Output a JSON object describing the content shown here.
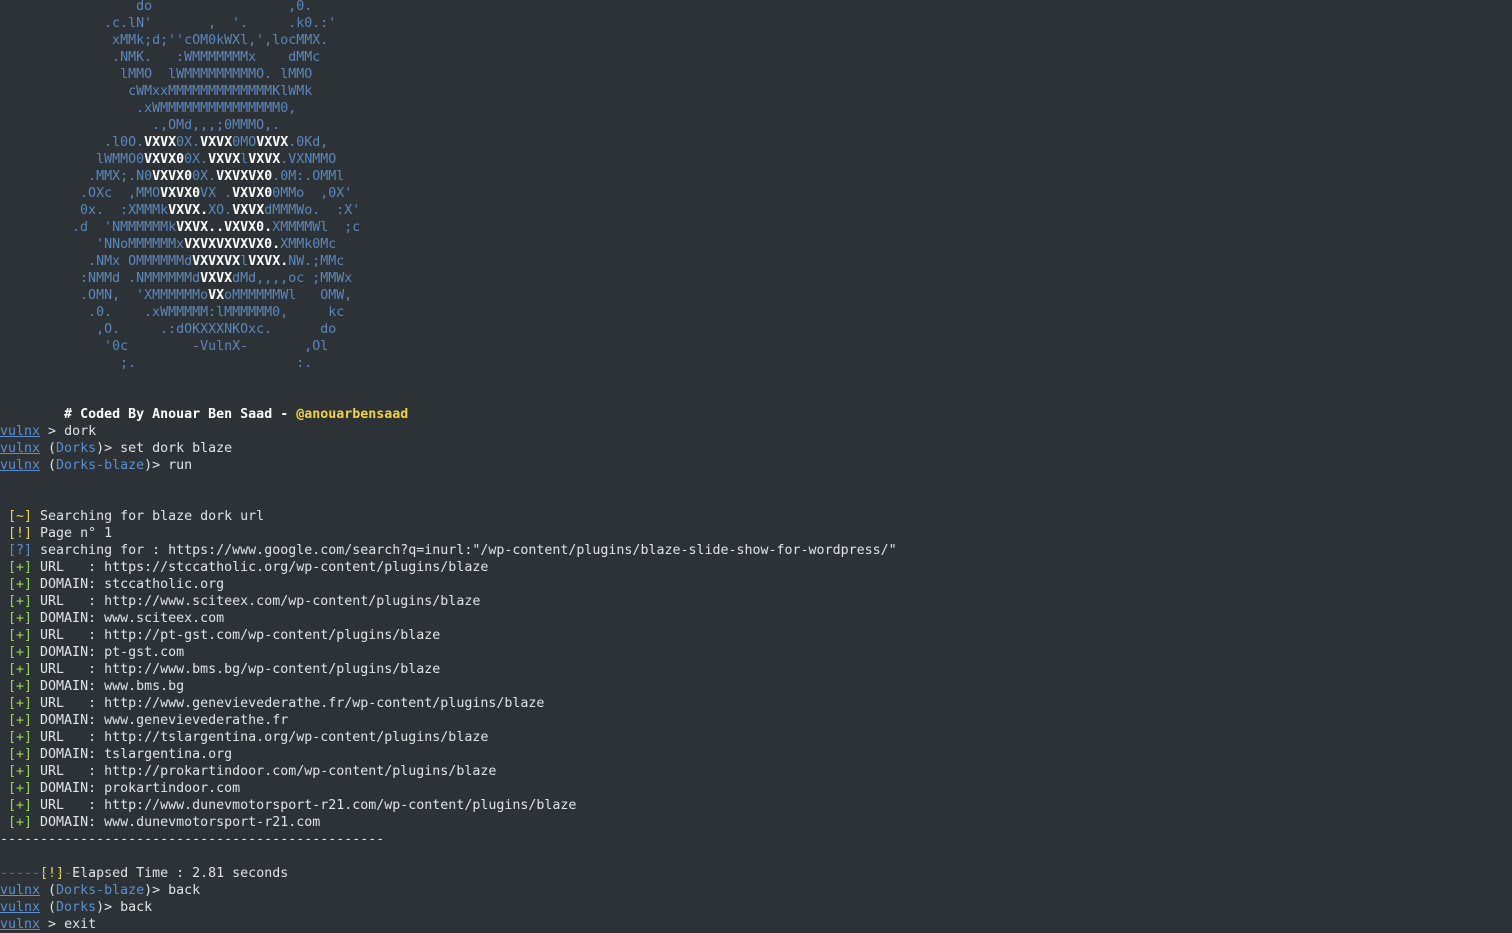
{
  "banner": {
    "art_lines": [
      [
        {
          "t": "                 do                 ,0.",
          "c": "b"
        }
      ],
      [
        {
          "t": "             .c.lN'       ,  '.     .k0.:'",
          "c": "b"
        }
      ],
      [
        {
          "t": "              xMMk;d;''cOM0kWXl,',locMMX.",
          "c": "b"
        }
      ],
      [
        {
          "t": "              .NMK.   :WMMMMMMMx    dMMc",
          "c": "b"
        }
      ],
      [
        {
          "t": "               lMMO  lWMMMMMMMMMO. lMMO",
          "c": "b"
        }
      ],
      [
        {
          "t": "                cWMxxMMMMMMMMMMMMMKlWMk",
          "c": "b"
        }
      ],
      [
        {
          "t": "                 .xWMMMMMMMMMMMMMMM0,",
          "c": "b"
        }
      ],
      [
        {
          "t": "                   .,OMd,,,;0MMMO,.",
          "c": "b"
        }
      ],
      [
        {
          "t": "             .l0O.",
          "c": "b"
        },
        {
          "t": "VXVX",
          "c": "w"
        },
        {
          "t": "0X.",
          "c": "b"
        },
        {
          "t": "VXVX",
          "c": "w"
        },
        {
          "t": "0MO",
          "c": "b"
        },
        {
          "t": "VXVX",
          "c": "w"
        },
        {
          "t": ".0Kd,",
          "c": "b"
        }
      ],
      [
        {
          "t": "            lWMMO0",
          "c": "b"
        },
        {
          "t": "VXVX0",
          "c": "w"
        },
        {
          "t": "0X.",
          "c": "b"
        },
        {
          "t": "VXVX",
          "c": "w"
        },
        {
          "t": "l",
          "c": "b"
        },
        {
          "t": "VXVX",
          "c": "w"
        },
        {
          "t": ".VXNMMO",
          "c": "b"
        }
      ],
      [
        {
          "t": "           .MMX;.N0",
          "c": "b"
        },
        {
          "t": "VXVX0",
          "c": "w"
        },
        {
          "t": "0X.",
          "c": "b"
        },
        {
          "t": "VXVXVX0",
          "c": "w"
        },
        {
          "t": ".0M:.OMMl",
          "c": "b"
        }
      ],
      [
        {
          "t": "          .OXc  ,MMO",
          "c": "b"
        },
        {
          "t": "VXVX0",
          "c": "w"
        },
        {
          "t": "VX .",
          "c": "b"
        },
        {
          "t": "VXVX0",
          "c": "w"
        },
        {
          "t": "0MMo  ,0X'",
          "c": "b"
        }
      ],
      [
        {
          "t": "          0x.  :XMMMk",
          "c": "b"
        },
        {
          "t": "VXVX.",
          "c": "w"
        },
        {
          "t": "XO.",
          "c": "b"
        },
        {
          "t": "VXVX",
          "c": "w"
        },
        {
          "t": "dMMMWo.  :X'",
          "c": "b"
        }
      ],
      [
        {
          "t": "         .d  'NMMMMMMk",
          "c": "b"
        },
        {
          "t": "VXVX..VXVX0.",
          "c": "w"
        },
        {
          "t": "XMMMMWl  ;c",
          "c": "b"
        }
      ],
      [
        {
          "t": "            'NNoMMMMMMx",
          "c": "b"
        },
        {
          "t": "VXVXVXVXVX0.",
          "c": "w"
        },
        {
          "t": "XMMk0Mc",
          "c": "b"
        }
      ],
      [
        {
          "t": "           .NMx OMMMMMMd",
          "c": "b"
        },
        {
          "t": "VXVXVX",
          "c": "w"
        },
        {
          "t": "l",
          "c": "b"
        },
        {
          "t": "VXVX.",
          "c": "w"
        },
        {
          "t": "NW.;MMc",
          "c": "b"
        }
      ],
      [
        {
          "t": "          :NMMd .NMMMMMMd",
          "c": "b"
        },
        {
          "t": "VXVX",
          "c": "w"
        },
        {
          "t": "dMd,,,,oc ;MMWx",
          "c": "b"
        }
      ],
      [
        {
          "t": "          .OMN,  'XMMMMMMo",
          "c": "b"
        },
        {
          "t": "VX",
          "c": "w"
        },
        {
          "t": "oMMMMMMWl   OMW,",
          "c": "b"
        }
      ],
      [
        {
          "t": "           .0.    .xWMMMMM:lMMMMMM0,     kc",
          "c": "b"
        }
      ],
      [
        {
          "t": "            ,O.     .:dOKXXXNKOxc.      do",
          "c": "b"
        }
      ],
      [
        {
          "t": "             '0c        -VulnX-       ,Ol",
          "c": "b"
        }
      ],
      [
        {
          "t": "               ;.                    :.",
          "c": "b"
        }
      ]
    ],
    "coded_by": "    # Coded By Anouar Ben Saad - ",
    "handle": "@anouarbensaad"
  },
  "session": {
    "prompt_name": "vulnx",
    "commands_top": [
      {
        "ctx_open": " > ",
        "ctx": "",
        "ctx_close": "",
        "cmd": "dork"
      },
      {
        "ctx_open": " (",
        "ctx": "Dorks",
        "ctx_close": ")> ",
        "cmd": "set dork blaze"
      },
      {
        "ctx_open": " (",
        "ctx": "Dorks-blaze",
        "ctx_close": ")> ",
        "cmd": "run"
      }
    ],
    "output_lines": [
      {
        "tag": " [~]",
        "tc": "y",
        "text": " Searching for blaze dork url"
      },
      {
        "tag": " [!]",
        "tc": "y",
        "text": " Page n° 1"
      },
      {
        "tag": " [?]",
        "tc": "b",
        "text": " searching for : https://www.google.com/search?q=inurl:\"/wp-content/plugins/blaze-slide-show-for-wordpress/\""
      },
      {
        "tag": " [+]",
        "tc": "g",
        "text": " URL   : https://stccatholic.org/wp-content/plugins/blaze"
      },
      {
        "tag": " [+]",
        "tc": "g",
        "text": " DOMAIN: stccatholic.org"
      },
      {
        "tag": " [+]",
        "tc": "g",
        "text": " URL   : http://www.sciteex.com/wp-content/plugins/blaze"
      },
      {
        "tag": " [+]",
        "tc": "g",
        "text": " DOMAIN: www.sciteex.com"
      },
      {
        "tag": " [+]",
        "tc": "g",
        "text": " URL   : http://pt-gst.com/wp-content/plugins/blaze"
      },
      {
        "tag": " [+]",
        "tc": "g",
        "text": " DOMAIN: pt-gst.com"
      },
      {
        "tag": " [+]",
        "tc": "g",
        "text": " URL   : http://www.bms.bg/wp-content/plugins/blaze"
      },
      {
        "tag": " [+]",
        "tc": "g",
        "text": " DOMAIN: www.bms.bg"
      },
      {
        "tag": " [+]",
        "tc": "g",
        "text": " URL   : http://www.genevievederathe.fr/wp-content/plugins/blaze"
      },
      {
        "tag": " [+]",
        "tc": "g",
        "text": " DOMAIN: www.genevievederathe.fr"
      },
      {
        "tag": " [+]",
        "tc": "g",
        "text": " URL   : http://tslargentina.org/wp-content/plugins/blaze"
      },
      {
        "tag": " [+]",
        "tc": "g",
        "text": " DOMAIN: tslargentina.org"
      },
      {
        "tag": " [+]",
        "tc": "g",
        "text": " URL   : http://prokartindoor.com/wp-content/plugins/blaze"
      },
      {
        "tag": " [+]",
        "tc": "g",
        "text": " DOMAIN: prokartindoor.com"
      },
      {
        "tag": " [+]",
        "tc": "g",
        "text": " URL   : http://www.dunevmotorsport-r21.com/wp-content/plugins/blaze"
      },
      {
        "tag": " [+]",
        "tc": "g",
        "text": " DOMAIN: www.dunevmotorsport-r21.com"
      }
    ],
    "separator_long": "------------------------------------------------",
    "elapsed": {
      "tag": " [!]",
      "text": " Elapsed Time : 2.81 seconds"
    },
    "separator_short": "---------------",
    "commands_bottom": [
      {
        "ctx_open": " (",
        "ctx": "Dorks-blaze",
        "ctx_close": ")> ",
        "cmd": "back"
      },
      {
        "ctx_open": " (",
        "ctx": "Dorks",
        "ctx_close": ")> ",
        "cmd": "back"
      },
      {
        "ctx_open": " > ",
        "ctx": "",
        "ctx_close": "",
        "cmd": "exit"
      }
    ]
  },
  "colors": {
    "background": "#2c3236",
    "text": "#e1e4e5",
    "art_blue": "#5b87bd",
    "prompt_blue": "#5c8fd0",
    "yellow": "#e9d44c",
    "handle_yellow": "#f3d53a",
    "green": "#9ad456"
  }
}
